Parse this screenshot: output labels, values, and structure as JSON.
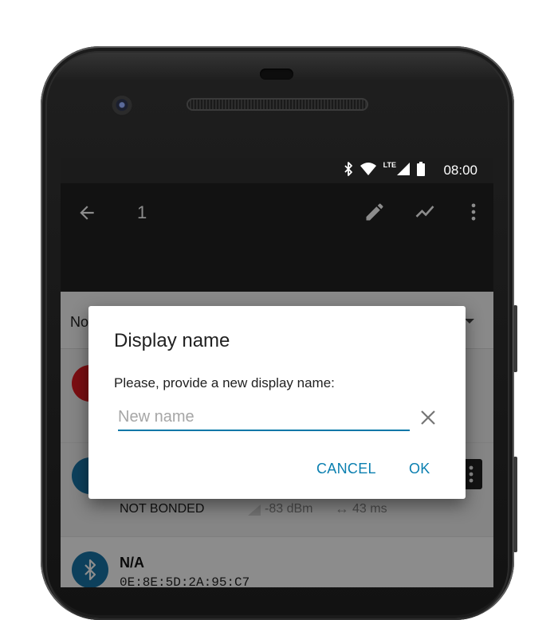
{
  "status_bar": {
    "time": "08:00",
    "network_label": "LTE",
    "icons": [
      "bluetooth-icon",
      "wifi-icon",
      "signal-icon",
      "battery-icon"
    ]
  },
  "app_bar": {
    "title": "1",
    "icons": [
      "back-arrow-icon",
      "edit-pencil-icon",
      "graph-icon",
      "more-vert-icon"
    ]
  },
  "filter_bar": {
    "label": "No"
  },
  "devices": [
    {
      "name": "",
      "address": "",
      "bond": "",
      "rssi": "",
      "interval": "",
      "avatar_color": "#e11b22"
    },
    {
      "name": "",
      "address": "",
      "bond": "NOT BONDED",
      "rssi": "-83 dBm",
      "interval": "43 ms",
      "avatar_color": "#1976a8"
    },
    {
      "name": "N/A",
      "address": "0E:8E:5D:2A:95:C7",
      "bond": "",
      "rssi": "",
      "interval": "",
      "avatar_color": "#1976a8"
    }
  ],
  "dialog": {
    "title": "Display name",
    "message": "Please, provide a new display name:",
    "input_value": "",
    "input_placeholder": "New name",
    "cancel_label": "CANCEL",
    "ok_label": "OK"
  },
  "colors": {
    "accent": "#0a7fb0",
    "app_bar": "#212121",
    "status_bar": "#1b1b1b"
  }
}
